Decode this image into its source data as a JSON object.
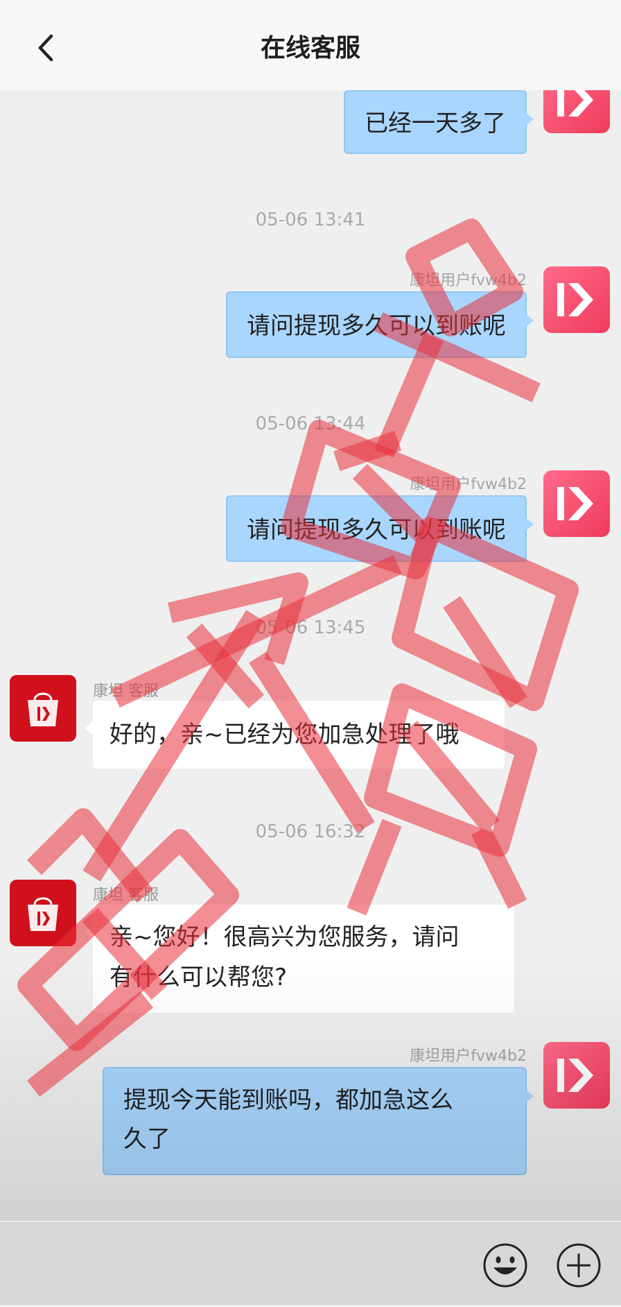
{
  "header": {
    "title": "在线客服"
  },
  "messages": {
    "m1": {
      "text": "已经一天多了"
    },
    "ts1": "05-06 13:41",
    "m2": {
      "sender": "康坦用户fvw4b2",
      "text": "请问提现多久可以到账呢"
    },
    "ts2": "05-06 13:44",
    "m3": {
      "sender": "康坦用户fvw4b2",
      "text": "请问提现多久可以到账呢"
    },
    "ts3": "05-06 13:45",
    "m4": {
      "sender": "康坦 客服",
      "text": "好的，亲~已经为您加急处理了哦"
    },
    "ts4": "05-06 16:32",
    "m5": {
      "sender": "康坦 客服",
      "line1": "亲~您好！很高兴为您服务，请问",
      "line2": "有什么可以帮您?"
    },
    "m6": {
      "sender": "康坦用户fvw4b2",
      "line1": "提现今天能到账吗，都加急这么",
      "line2": "久了"
    }
  },
  "watermark_text": "大家别被骗了",
  "colors": {
    "my_bubble": "#a9d6ff",
    "their_bubble": "#ffffff",
    "user_avatar": "#ef3b5c",
    "service_avatar": "#d0101a",
    "watermark": "#e8323c"
  },
  "icons": {
    "back": "chevron-left-icon",
    "emoji": "smiley-icon",
    "plus": "plus-circle-icon"
  }
}
